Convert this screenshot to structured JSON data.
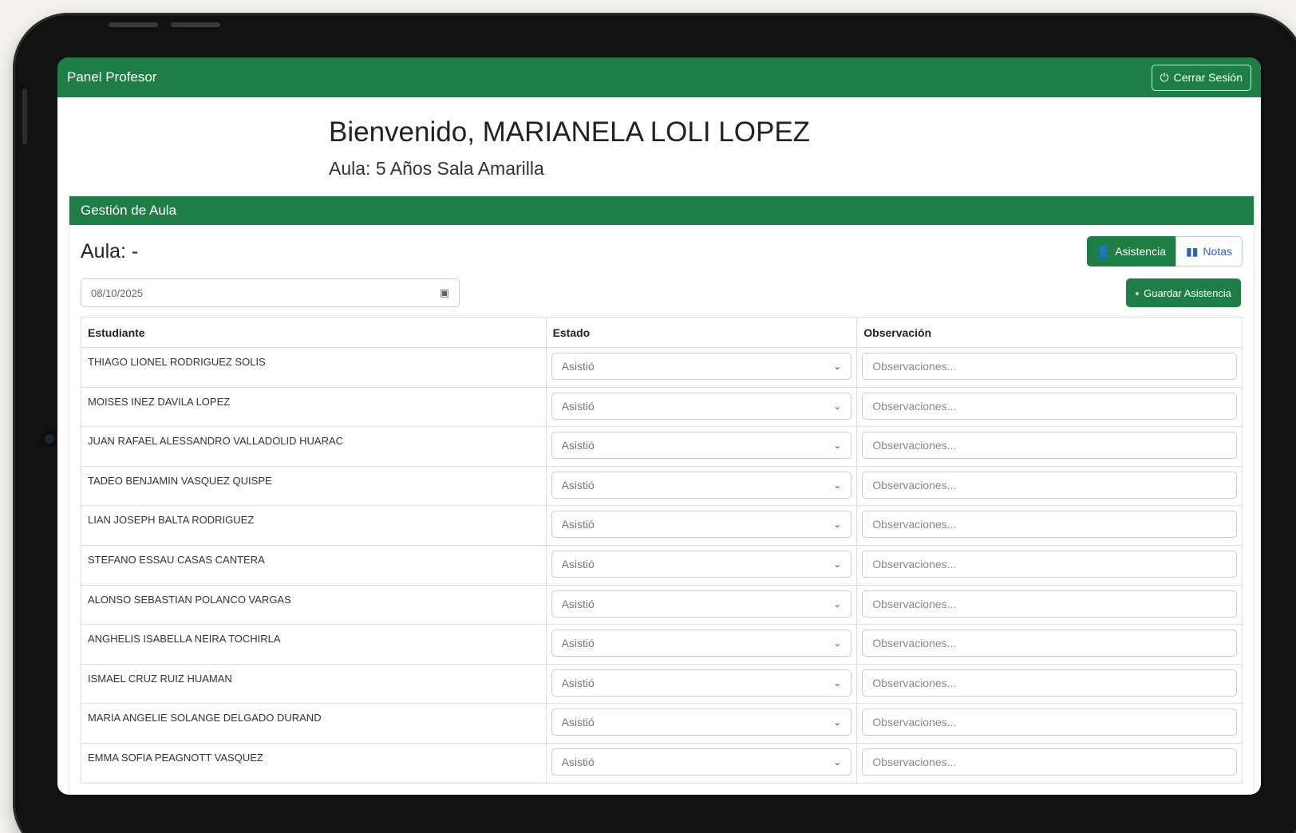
{
  "navbar": {
    "brand": "Panel Profesor",
    "logout_label": "Cerrar Sesión"
  },
  "welcome": {
    "greeting": "Bienvenido, MARIANELA LOLI LOPEZ",
    "classroom": "Aula: 5 Años Sala Amarilla"
  },
  "card": {
    "header": "Gestión de Aula",
    "title": "Aula: -",
    "toggle_active": "Asistencia",
    "toggle_inactive": "Notas",
    "date_value": "08/10/2025",
    "save_label": "Guardar Asistencia"
  },
  "table": {
    "headers": [
      "Estudiante",
      "Estado",
      "Observación"
    ],
    "status_value": "Asistió",
    "obs_placeholder": "Observaciones...",
    "rows": [
      {
        "name": "THIAGO LIONEL RODRIGUEZ SOLIS"
      },
      {
        "name": "MOISES INEZ DAVILA LOPEZ"
      },
      {
        "name": "JUAN RAFAEL ALESSANDRO VALLADOLID HUARAC"
      },
      {
        "name": "TADEO BENJAMIN VASQUEZ QUISPE"
      },
      {
        "name": "LIAN JOSEPH BALTA RODRIGUEZ"
      },
      {
        "name": "STEFANO ESSAU CASAS CANTERA"
      },
      {
        "name": "ALONSO SEBASTIAN POLANCO VARGAS"
      },
      {
        "name": "ANGHELIS ISABELLA NEIRA TOCHIRLA"
      },
      {
        "name": "ISMAEL CRUZ RUIZ HUAMAN"
      },
      {
        "name": "MARIA ANGELIE SOLANGE DELGADO DURAND"
      },
      {
        "name": "EMMA SOFIA PEAGNOTT VASQUEZ"
      }
    ]
  }
}
